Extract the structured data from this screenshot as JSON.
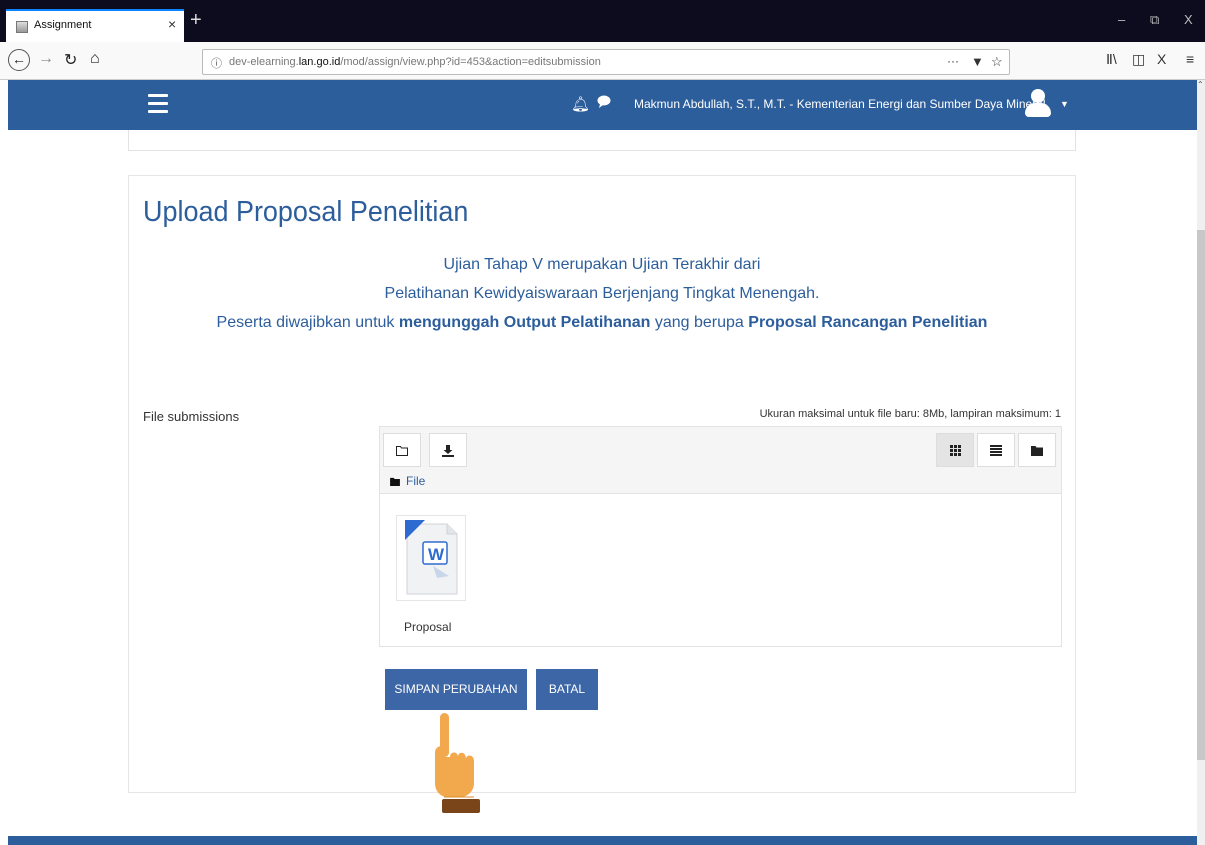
{
  "browser": {
    "tab_title": "Assignment",
    "tab_close": "×",
    "new_tab": "+",
    "window_controls": {
      "minimize": "–",
      "restore": "⧉",
      "close": "X"
    },
    "url_prefix": "dev-elearning.",
    "url_host": "lan.go.id",
    "url_path": "/mod/assign/view.php?id=453&action=editsubmission",
    "url_more": "···",
    "icons": [
      "back-icon",
      "forward-icon",
      "reload-icon",
      "home-icon",
      "info-icon",
      "pocket-icon",
      "bookmark-star-icon",
      "library-icon",
      "sidebar-icon",
      "extension-icon",
      "menu-icon"
    ]
  },
  "header": {
    "user_label": "Makmun Abdullah, S.T., M.T. - Kementerian Energi dan Sumber Daya Mineral",
    "color": "#2d5e9c"
  },
  "page": {
    "title": "Upload Proposal Penelitian",
    "desc_line1": "Ujian Tahap V merupakan Ujian Terakhir dari",
    "desc_line2": "Pelatihanan Kewidyaiswaraan Berjenjang Tingkat Menengah.",
    "desc_line3_a": "Peserta diwajibkan untuk ",
    "desc_line3_b": "mengunggah Output Pelatihanan",
    "desc_line3_c": " yang berupa ",
    "desc_line3_d": "Proposal Rancangan Penelitian"
  },
  "submission": {
    "label": "File submissions",
    "limit_text": "Ukuran maksimal untuk file baru: 8Mb, lampiran maksimum: 1",
    "path_label": "File",
    "file_name": "Proposal",
    "view_mode": "icons"
  },
  "actions": {
    "save_label": "SIMPAN PERUBAHAN",
    "cancel_label": "BATAL",
    "button_color": "#3d66a6"
  }
}
